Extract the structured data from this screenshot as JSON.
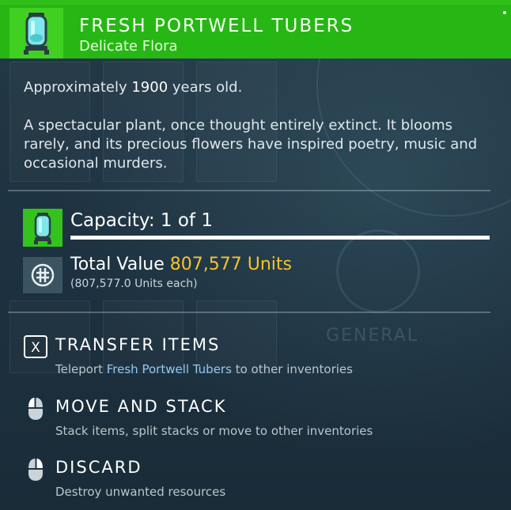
{
  "header": {
    "title": "FRESH PORTWELL TUBERS",
    "subtitle": "Delicate Flora",
    "icon": "tuber-jar-icon",
    "accent_color": "#27b715"
  },
  "description": {
    "age_prefix": "Approximately ",
    "age_value": "1900",
    "age_suffix": " years old.",
    "lore_line1": "A spectacular plant, once thought entirely extinct. It blooms",
    "lore_line2": "rarely, and its precious flowers have inspired poetry, music and",
    "lore_line3": "occasional murders."
  },
  "capacity": {
    "label": "Capacity: 1 of 1",
    "fill_fraction": 1.0,
    "icon": "tuber-jar-icon"
  },
  "value": {
    "label": "Total Value",
    "amount": "807,577 Units",
    "each": "(807,577.0 Units each)",
    "amount_color": "#f6c32c",
    "icon": "units-currency-icon"
  },
  "actions": [
    {
      "title": "TRANSFER ITEMS",
      "sub_prefix": "Teleport ",
      "sub_highlight": "Fresh Portwell Tubers",
      "sub_suffix": " to other inventories",
      "icon": "x-key-icon",
      "key": "X"
    },
    {
      "title": "MOVE AND STACK",
      "sub": "Stack items, split stacks or move to other inventories",
      "icon": "mouse-left-click-icon"
    },
    {
      "title": "DISCARD",
      "sub": "Destroy unwanted resources",
      "icon": "mouse-right-click-icon"
    }
  ],
  "background": {
    "ghost_label": "GENERAL"
  }
}
